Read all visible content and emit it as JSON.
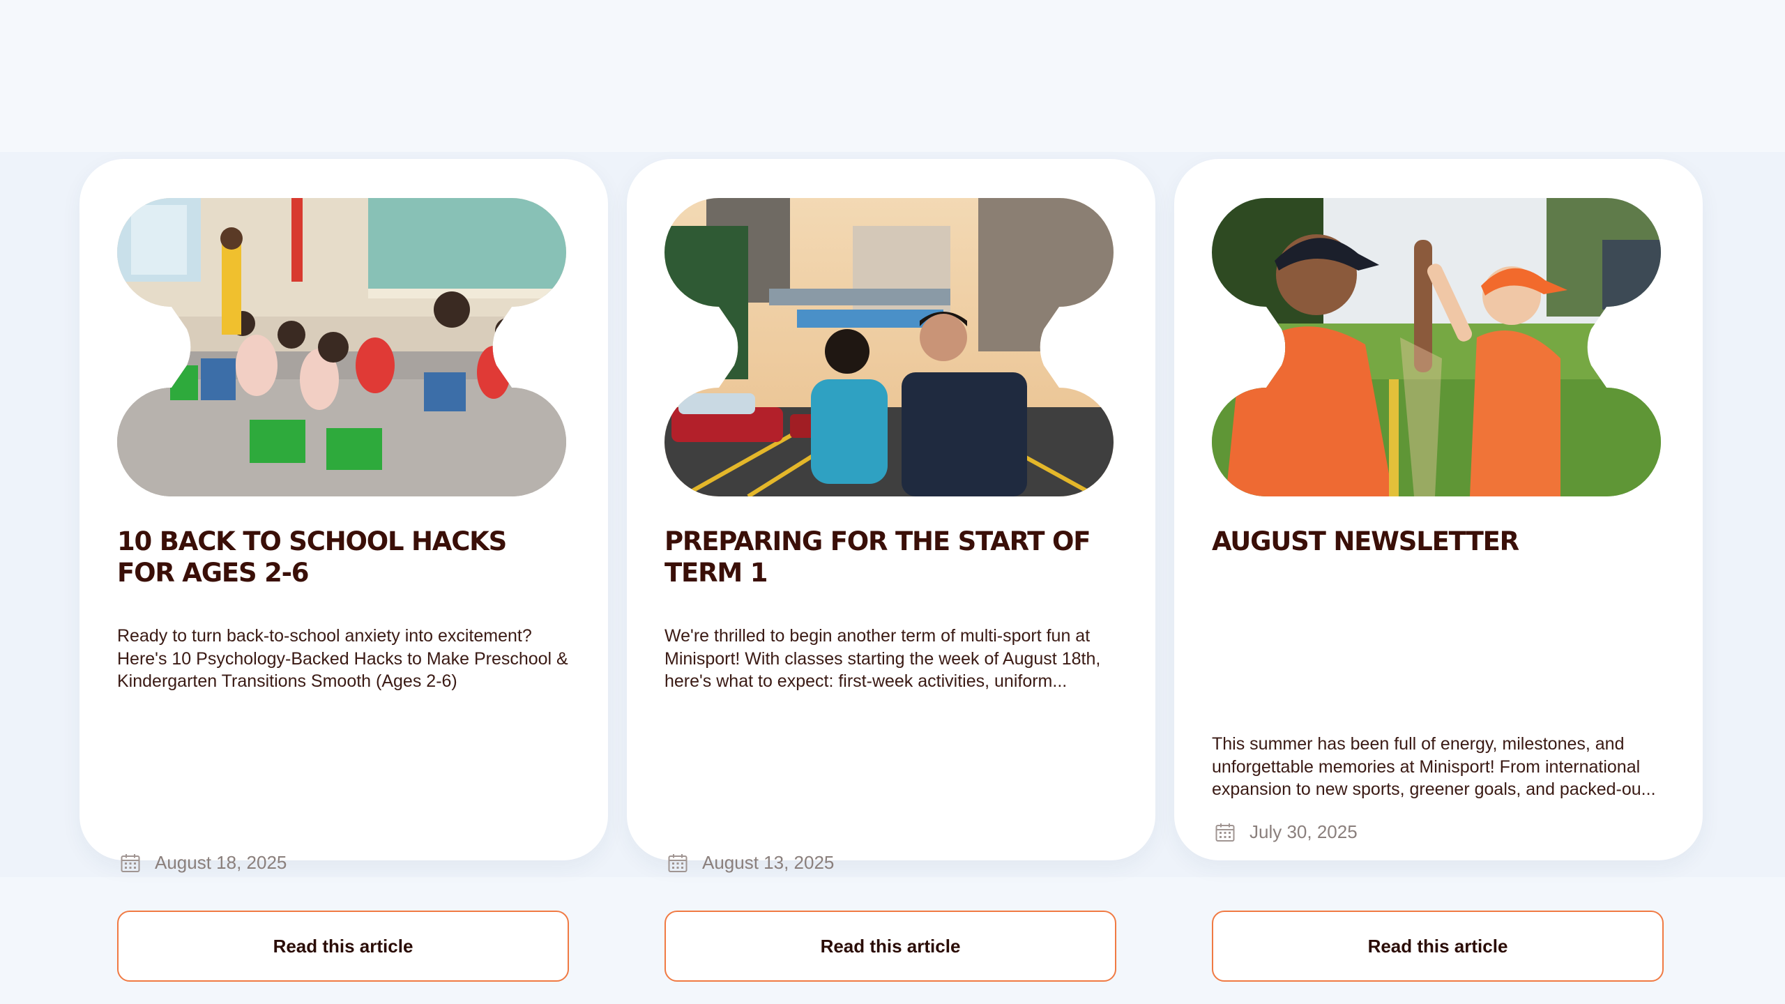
{
  "colors": {
    "page_background": "#f3f7fc",
    "card_background": "#ffffff",
    "title": "#3a0f08",
    "body_text": "#3a1a14",
    "date_text": "#8a7f7c",
    "button_border": "#f07a43",
    "button_text": "#2a0c06"
  },
  "icons": {
    "date": "calendar-icon"
  },
  "articles": [
    {
      "title": "10 BACK TO SCHOOL HACKS FOR AGES 2-6",
      "excerpt": "Ready to turn back-to-school anxiety into excitement? Here's 10 Psychology-Backed Hacks to Make Preschool & Kindergarten Transitions Smooth (Ages 2-6)",
      "date": "August 18, 2025",
      "button_label": "Read this article",
      "image_subject": "classroom photo of young children raising hands"
    },
    {
      "title": "PREPARING FOR THE START OF TERM 1",
      "excerpt": "We're thrilled to begin another term of multi-sport fun at Minisport! With classes starting the week of August 18th, here's what to expect: first-week activities, uniform...",
      "date": "August 13, 2025",
      "button_label": "Read this article",
      "image_subject": "adult high-fiving a child outside a school gate"
    },
    {
      "title": "AUGUST NEWSLETTER",
      "excerpt": "This summer has been full of energy, milestones, and unforgettable memories at Minisport! From international expansion to new sports, greener goals, and packed-ou...",
      "date": "July 30, 2025",
      "button_label": "Read this article",
      "image_subject": "coach high-fiving a child in orange sports kit on grass"
    }
  ]
}
